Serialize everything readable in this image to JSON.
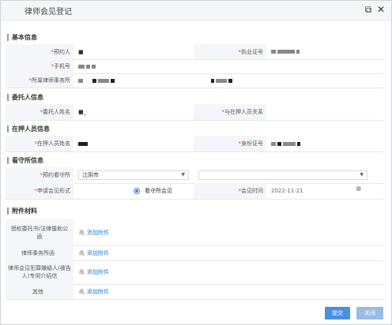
{
  "window": {
    "title": "律师会见登记"
  },
  "sections": {
    "basic": "基本信息",
    "client": "委托人信息",
    "detainee": "在押人员信息",
    "facility": "看守所信息",
    "attachments": "附件材料"
  },
  "basic": {
    "appointee_label": "预约人",
    "appointee_value": "■",
    "license_label": "执业证号",
    "phone_label": "手机号",
    "firm_label": "所属律师事务所"
  },
  "client": {
    "name_label": "委托人姓名",
    "name_value": "■_",
    "relation_label": "与在押人员关系"
  },
  "detainee": {
    "name_label": "在押人员姓名",
    "id_label": "身份证号"
  },
  "facility": {
    "appt_label": "预约看守所",
    "appt_select": "江阴市",
    "method_label": "申请会见形式",
    "method_option": "看守所会见",
    "time_label": "会见时间",
    "time_value": "2022-11-21"
  },
  "attachments": {
    "rows": [
      {
        "label": "授权委托书/法律援助公函",
        "action": "添加附件"
      },
      {
        "label": "律师事务所函",
        "action": "添加附件"
      },
      {
        "label": "律师会见犯罪嫌疑人(被告人)专用介绍信",
        "action": "添加附件"
      },
      {
        "label": "其他",
        "action": "添加附件"
      }
    ]
  },
  "buttons": {
    "submit": "提交",
    "close": "关闭"
  },
  "colors": {
    "primary": "#4a90e2",
    "disabled": "#9bbbe3",
    "required": "#e44444",
    "link": "#2a7fd6"
  },
  "icons": {
    "maximize": "maximize-icon",
    "close": "close-icon",
    "calendar": "calendar-icon",
    "attach": "paperclip-icon"
  }
}
